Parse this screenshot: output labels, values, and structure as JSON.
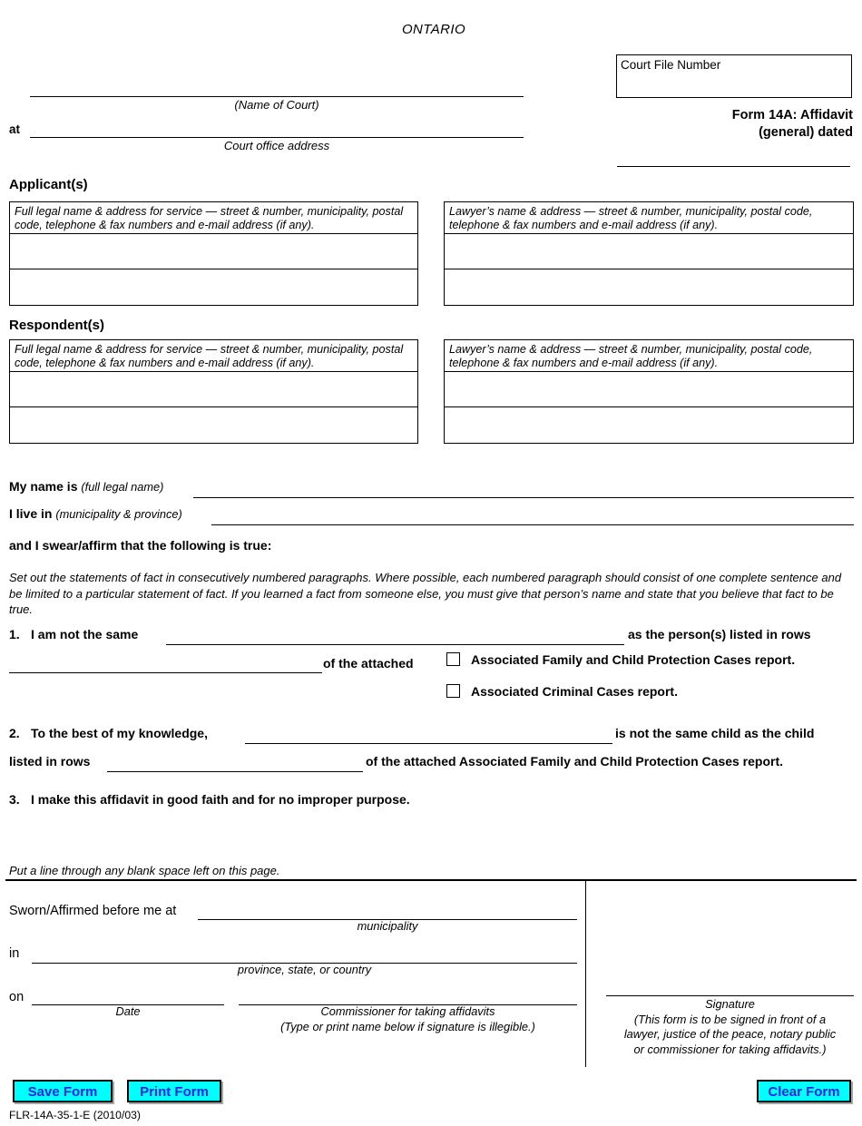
{
  "header": {
    "jurisdiction": "ONTARIO",
    "court_name_caption": "(Name of Court)",
    "at_label": "at",
    "court_address_caption": "Court office address",
    "court_file_number_label": "Court File Number",
    "form_title_line1": "Form 14A: Affidavit",
    "form_title_line2": "(general) dated"
  },
  "parties": {
    "applicants_heading": "Applicant(s)",
    "respondents_heading": "Respondent(s)",
    "party_column_header": "Full legal name & address for service — street & number, municipality, postal code, telephone & fax numbers and e-mail address (if any).",
    "lawyer_column_header": "Lawyer’s name & address — street & number, municipality, postal code, telephone & fax numbers and e-mail address (if any)."
  },
  "deponent": {
    "my_name_is_label": "My name is",
    "my_name_is_hint": "(full legal name)",
    "i_live_in_label": "I live in",
    "i_live_in_hint": "(municipality & province)",
    "swear_line": "and I swear/affirm that the following is true:",
    "set_out_note": "Set out the statements of fact in consecutively numbered paragraphs. Where possible, each numbered paragraph should consist of one complete sentence and be limited to a particular statement of fact. If you learned a fact from someone else, you must give that person’s name and state that you believe that fact to be true."
  },
  "paragraphs": {
    "p1": {
      "number": "1.",
      "text_a": "I am not the same",
      "text_b": "as the person(s) listed in rows",
      "text_c": "of the attached",
      "checkbox_1_label": "Associated Family and Child Protection Cases report.",
      "checkbox_2_label": "Associated Criminal Cases report."
    },
    "p2": {
      "number": "2.",
      "text_a": "To the best of my knowledge,",
      "text_b": "is not the same child as the child",
      "text_c": "listed in rows",
      "text_d": "of the attached Associated Family and Child Protection Cases report."
    },
    "p3": {
      "number": "3.",
      "text_a": "I make this affidavit in good faith and for no improper purpose."
    }
  },
  "jurat": {
    "blank_space_note": "Put a line through any blank space left on this page.",
    "sworn_label": "Sworn/Affirmed before me at",
    "municipality_caption": "municipality",
    "in_label": "in",
    "province_caption": "province, state, or country",
    "on_label": "on",
    "date_caption": "Date",
    "commissioner_caption_line1": "Commissioner for taking affidavits",
    "commissioner_caption_line2": "(Type or print name below if signature is illegible.)",
    "signature_caption_line1": "Signature",
    "signature_caption_line2": "(This form is to be signed in front of a",
    "signature_caption_line3": "lawyer, justice of the peace, notary public",
    "signature_caption_line4": "or commissioner for taking affidavits.)"
  },
  "toolbar": {
    "save_label": "Save Form",
    "print_label": "Print Form",
    "clear_label": "Clear Form",
    "button_fill": "#00FFFF",
    "button_text_color": "#2222EE"
  },
  "footer": {
    "form_code": "FLR-14A-35-1-E (2010/03)"
  }
}
